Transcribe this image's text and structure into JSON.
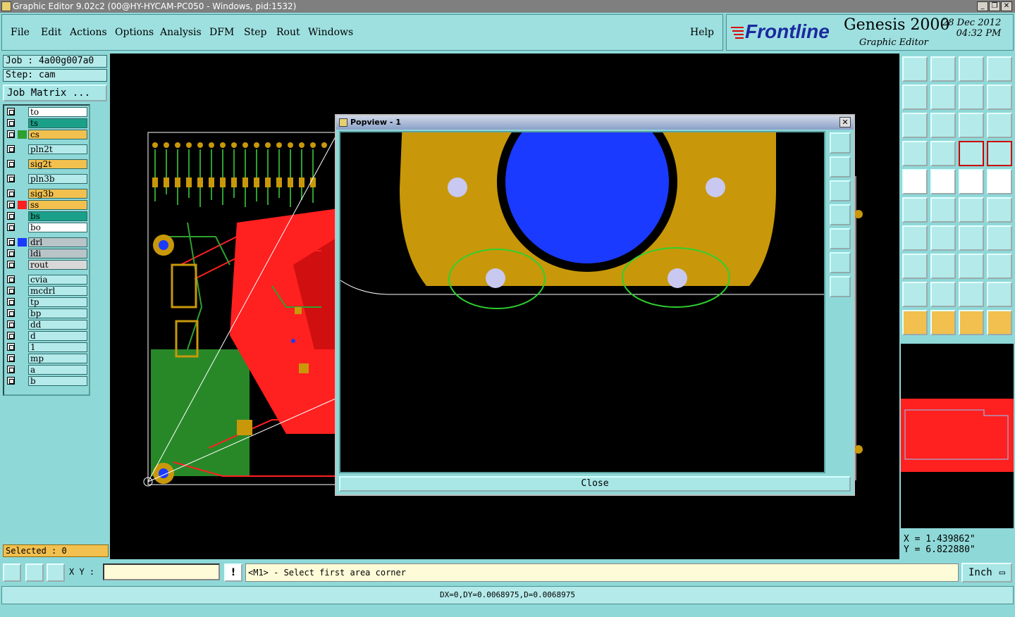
{
  "window": {
    "title": "Graphic Editor 9.02c2 (00@HY-HYCAM-PC050 - Windows, pid:1532)"
  },
  "menu": [
    "File",
    "Edit",
    "Actions",
    "Options",
    "Analysis",
    "DFM",
    "Step",
    "Rout",
    "Windows"
  ],
  "help": "Help",
  "logo": {
    "brand": "Frontline",
    "product": "Genesis 2000",
    "subtitle": "Graphic Editor",
    "date": "28 Dec 2012",
    "time": "04:32 PM"
  },
  "job": {
    "job_text": "Job : 4a00g007a0",
    "step_text": "Step: cam",
    "job_matrix": "Job Matrix ..."
  },
  "layers": [
    {
      "name": "to",
      "color": "",
      "bg": "#ffffff"
    },
    {
      "name": "ts",
      "color": "",
      "bg": "#1aa088"
    },
    {
      "name": "cs",
      "color": "#2fa02f",
      "bg": "#f2c04e"
    },
    {
      "name": "pln2t",
      "color": "",
      "bg": "#b4eaea"
    },
    {
      "name": "sig2t",
      "color": "",
      "bg": "#f2c04e"
    },
    {
      "name": "pln3b",
      "color": "",
      "bg": "#b4eaea"
    },
    {
      "name": "sig3b",
      "color": "",
      "bg": "#f2c04e"
    },
    {
      "name": "ss",
      "color": "#ff2020",
      "bg": "#f2c04e"
    },
    {
      "name": "bs",
      "color": "",
      "bg": "#1aa088"
    },
    {
      "name": "bo",
      "color": "",
      "bg": "#ffffff"
    },
    {
      "name": "drl",
      "color": "#1a3aff",
      "bg": "#b8c4c8"
    },
    {
      "name": "ldi",
      "color": "",
      "bg": "#b8c4c8"
    },
    {
      "name": "rout",
      "color": "",
      "bg": "#d8d8d8"
    },
    {
      "name": "cvia",
      "color": "",
      "bg": "#b4eaea"
    },
    {
      "name": "mcdrl",
      "color": "",
      "bg": "#b4eaea"
    },
    {
      "name": "tp",
      "color": "",
      "bg": "#b4eaea"
    },
    {
      "name": "bp",
      "color": "",
      "bg": "#b4eaea"
    },
    {
      "name": "dd",
      "color": "",
      "bg": "#b4eaea"
    },
    {
      "name": "d",
      "color": "",
      "bg": "#b4eaea"
    },
    {
      "name": "1",
      "color": "",
      "bg": "#b4eaea"
    },
    {
      "name": "mp",
      "color": "",
      "bg": "#b4eaea"
    },
    {
      "name": "a",
      "color": "",
      "bg": "#b4eaea"
    },
    {
      "name": "b",
      "color": "",
      "bg": "#b4eaea"
    }
  ],
  "selected_text": "Selected : 0",
  "popview": {
    "title": "Popview - 1",
    "close_label": "Close"
  },
  "coords": {
    "x_text": "X = 1.439862\"",
    "y_text": "Y = 6.822880\""
  },
  "bottom": {
    "xy_label": "X Y :",
    "xy_value": "",
    "prompt": "<M1> - Select first area corner",
    "unit": "Inch"
  },
  "status": "DX=0,DY=0.0068975,D=0.0068975",
  "colors": {
    "board_red": "#ff2020",
    "copper": "#c8980a",
    "drill_blue": "#1a3aff",
    "layer_green": "#2fa02f",
    "highlight": "#f2c04e"
  }
}
